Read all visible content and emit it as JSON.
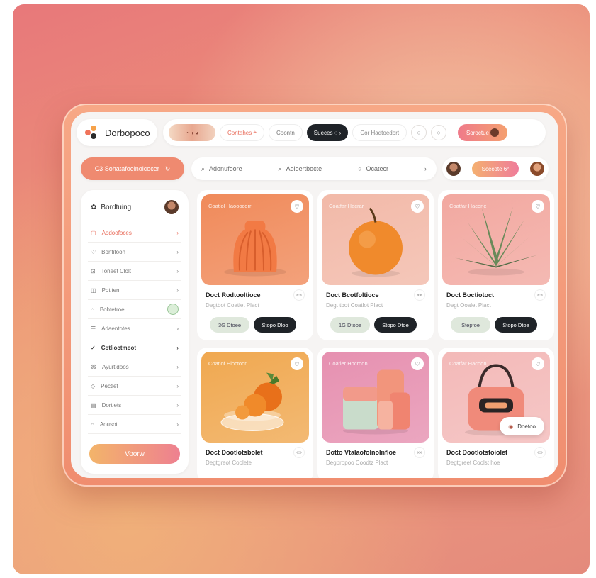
{
  "brand": {
    "name": "Dorbopoco"
  },
  "topbar": {
    "thumb_label": "",
    "items": [
      "Contahes",
      "Coontn",
      "Sueces",
      "Cor Hadtoedort"
    ],
    "active_item": "Sueces",
    "cta": "Soroctue"
  },
  "secondrow": {
    "left_button": "C3 Sohatafoelnolcocer",
    "search": [
      "Adonufoore",
      "Aoloertbocte",
      "Ocatecr"
    ],
    "right_button": "Scecote 6°"
  },
  "sidebar": {
    "title": "Bordtuing",
    "items": [
      {
        "label": "Aodoofoces",
        "state": "active"
      },
      {
        "label": "Bontitoon",
        "state": ""
      },
      {
        "label": "Toneet Clolt",
        "state": ""
      },
      {
        "label": "Potiten",
        "state": ""
      },
      {
        "label": "Bohtetroe",
        "state": "toggle"
      },
      {
        "label": "Adaentotes",
        "state": ""
      },
      {
        "label": "Cotlioctmoot",
        "state": "bold"
      },
      {
        "label": "Ayurtidoos",
        "state": ""
      },
      {
        "label": "Pectlet",
        "state": ""
      },
      {
        "label": "Dortlets",
        "state": ""
      },
      {
        "label": "Aousot",
        "state": ""
      }
    ],
    "button": "Voorw"
  },
  "cards": [
    {
      "tag": "Coatlol Haooocorr",
      "title": "Doct Rodtooltioce",
      "subtitle": "Degtbot Coatlet Plact",
      "btn1": "3G Dtoee",
      "btn2": "Stopo Dloo",
      "bg": "#f08a5a",
      "object": "vase"
    },
    {
      "tag": "Coatfar Hacrar",
      "title": "Doct Bcotfoltioce",
      "subtitle": "Degt tbot Coatlot Plact",
      "btn1": "1G Dtooe",
      "btn2": "Stopo Dtoe",
      "bg": "#f2b9a8",
      "object": "orange"
    },
    {
      "tag": "Coatfar Hacone",
      "title": "Doct Boctiotoct",
      "subtitle": "Degt Ooalet Plact",
      "btn1": "Stepfoe",
      "btn2": "Stopo Dtoe",
      "bg": "#f2a8a0",
      "object": "plant"
    },
    {
      "tag": "Coatlof Hioctoon",
      "title": "Doct Dootlotsbolet",
      "subtitle": "Degtgreot Coolete",
      "btn1": "",
      "btn2": "",
      "bg": "#f0a850",
      "object": "bowl"
    },
    {
      "tag": "Coatler Hocroon",
      "title": "Dotto Vtalaofolnolnfloe",
      "subtitle": "Degbropoo Coodtz Plact",
      "btn1": "",
      "btn2": "",
      "bg": "#e690b0",
      "object": "blocks"
    },
    {
      "tag": "Coatfar Hacoon",
      "title": "Doct Dootlotsfoiolet",
      "subtitle": "Degtgreet Coolst hoe",
      "btn1": "",
      "btn2": "",
      "bg": "#f3b9b8",
      "object": "bag",
      "chip": "Doetoo"
    }
  ]
}
